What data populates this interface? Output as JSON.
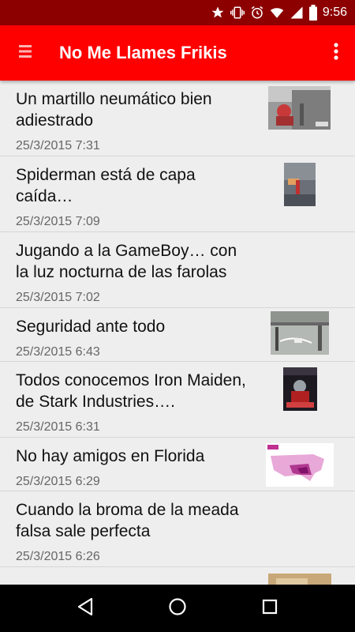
{
  "status_bar": {
    "time": "9:56",
    "icons": [
      "star-icon",
      "vibrate-icon",
      "alarm-icon",
      "wifi-icon",
      "signal-icon",
      "battery-icon"
    ]
  },
  "app_bar": {
    "title": "No Me Llames Frikis",
    "background": "#ff0000",
    "menu_icon": "hamburger-menu-icon",
    "overflow_icon": "more-vertical-icon"
  },
  "articles": [
    {
      "title": "Un martillo neumático bien adiestrado",
      "date": "25/3/2015 7:31",
      "has_thumbnail": true
    },
    {
      "title": "Spiderman está de capa caída…",
      "date": "25/3/2015 7:09",
      "has_thumbnail": true
    },
    {
      "title": "Jugando a la GameBoy… con la luz nocturna de las farolas",
      "date": "25/3/2015 7:02",
      "has_thumbnail": false
    },
    {
      "title": "Seguridad ante todo",
      "date": "25/3/2015 6:43",
      "has_thumbnail": true
    },
    {
      "title": "Todos conocemos Iron Maiden, de Stark Industries….",
      "date": "25/3/2015 6:31",
      "has_thumbnail": true
    },
    {
      "title": "No hay amigos en Florida",
      "date": "25/3/2015 6:29",
      "has_thumbnail": true
    },
    {
      "title": "Cuando la broma de la meada falsa sale perfecta",
      "date": "25/3/2015 6:26",
      "has_thumbnail": false
    }
  ],
  "nav_bar": {
    "icons": [
      "back-icon",
      "home-icon",
      "recents-icon"
    ]
  }
}
